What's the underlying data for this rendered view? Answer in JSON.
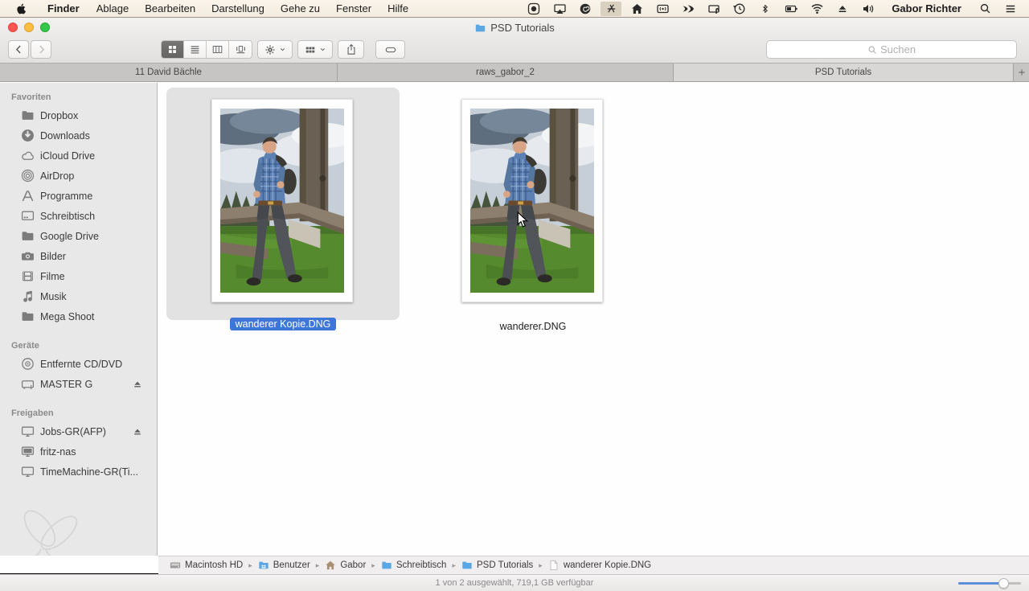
{
  "colors": {
    "selection_blue": "#3b76d8",
    "folder_blue": "#5aa7e4",
    "segment_active": "#6d6b69"
  },
  "menu_bar": {
    "items": [
      "Finder",
      "Ablage",
      "Bearbeiten",
      "Darstellung",
      "Gehe zu",
      "Fenster",
      "Hilfe"
    ],
    "username": "Gabor Richter",
    "status_icons": [
      "record-icon",
      "display-mirroring-icon",
      "creative-cloud-icon",
      "wacom-icon",
      "home-icon",
      "remote-icon",
      "wings-icon",
      "tablet-icon",
      "time-machine-icon",
      "bluetooth-icon",
      "wifi-icon",
      "eject-icon",
      "volume-icon",
      "spotlight-icon",
      "notification-center-icon"
    ]
  },
  "window": {
    "title": "PSD Tutorials",
    "toolbar": {
      "back": "back",
      "forward": "forward",
      "views": [
        "icon-view",
        "list-view",
        "column-view",
        "coverflow-view"
      ],
      "search_placeholder": "Suchen"
    },
    "tabs": [
      {
        "label": "11 David Bächle",
        "active": false
      },
      {
        "label": "raws_gabor_2",
        "active": false
      },
      {
        "label": "PSD Tutorials",
        "active": true
      }
    ],
    "sidebar": {
      "sections": [
        {
          "title": "Favoriten",
          "items": [
            {
              "label": "Dropbox",
              "icon": "folder-icon"
            },
            {
              "label": "Downloads",
              "icon": "downloads-icon"
            },
            {
              "label": "iCloud Drive",
              "icon": "cloud-icon"
            },
            {
              "label": "AirDrop",
              "icon": "airdrop-icon"
            },
            {
              "label": "Programme",
              "icon": "applications-icon"
            },
            {
              "label": "Schreibtisch",
              "icon": "desktop-icon"
            },
            {
              "label": "Google Drive",
              "icon": "folder-icon"
            },
            {
              "label": "Bilder",
              "icon": "pictures-icon"
            },
            {
              "label": "Filme",
              "icon": "movies-icon"
            },
            {
              "label": "Musik",
              "icon": "music-icon"
            },
            {
              "label": "Mega Shoot",
              "icon": "folder-icon"
            }
          ]
        },
        {
          "title": "Geräte",
          "items": [
            {
              "label": "Entfernte CD/DVD",
              "icon": "disc-icon",
              "eject": false
            },
            {
              "label": "MASTER G",
              "icon": "external-drive-icon",
              "eject": true
            }
          ]
        },
        {
          "title": "Freigaben",
          "items": [
            {
              "label": "Jobs-GR(AFP)",
              "icon": "network-display-icon",
              "eject": true
            },
            {
              "label": "fritz-nas",
              "icon": "network-display-dark-icon",
              "eject": false
            },
            {
              "label": "TimeMachine-GR(Ti...",
              "icon": "network-display-icon",
              "eject": false
            }
          ]
        }
      ]
    },
    "files": [
      {
        "name": "wanderer Kopie.DNG",
        "selected": true
      },
      {
        "name": "wanderer.DNG",
        "selected": false
      }
    ],
    "path_bar": {
      "separator": "▸",
      "segments": [
        {
          "label": "Macintosh HD",
          "icon": "hard-drive-icon"
        },
        {
          "label": "Benutzer",
          "icon": "users-folder-icon"
        },
        {
          "label": "Gabor",
          "icon": "home-folder-icon"
        },
        {
          "label": "Schreibtisch",
          "icon": "folder-icon"
        },
        {
          "label": "PSD Tutorials",
          "icon": "folder-icon"
        },
        {
          "label": "wanderer Kopie.DNG",
          "icon": "document-icon"
        }
      ]
    },
    "status_bar": {
      "text": "1 von 2 ausgewählt, 719,1 GB verfügbar"
    }
  }
}
